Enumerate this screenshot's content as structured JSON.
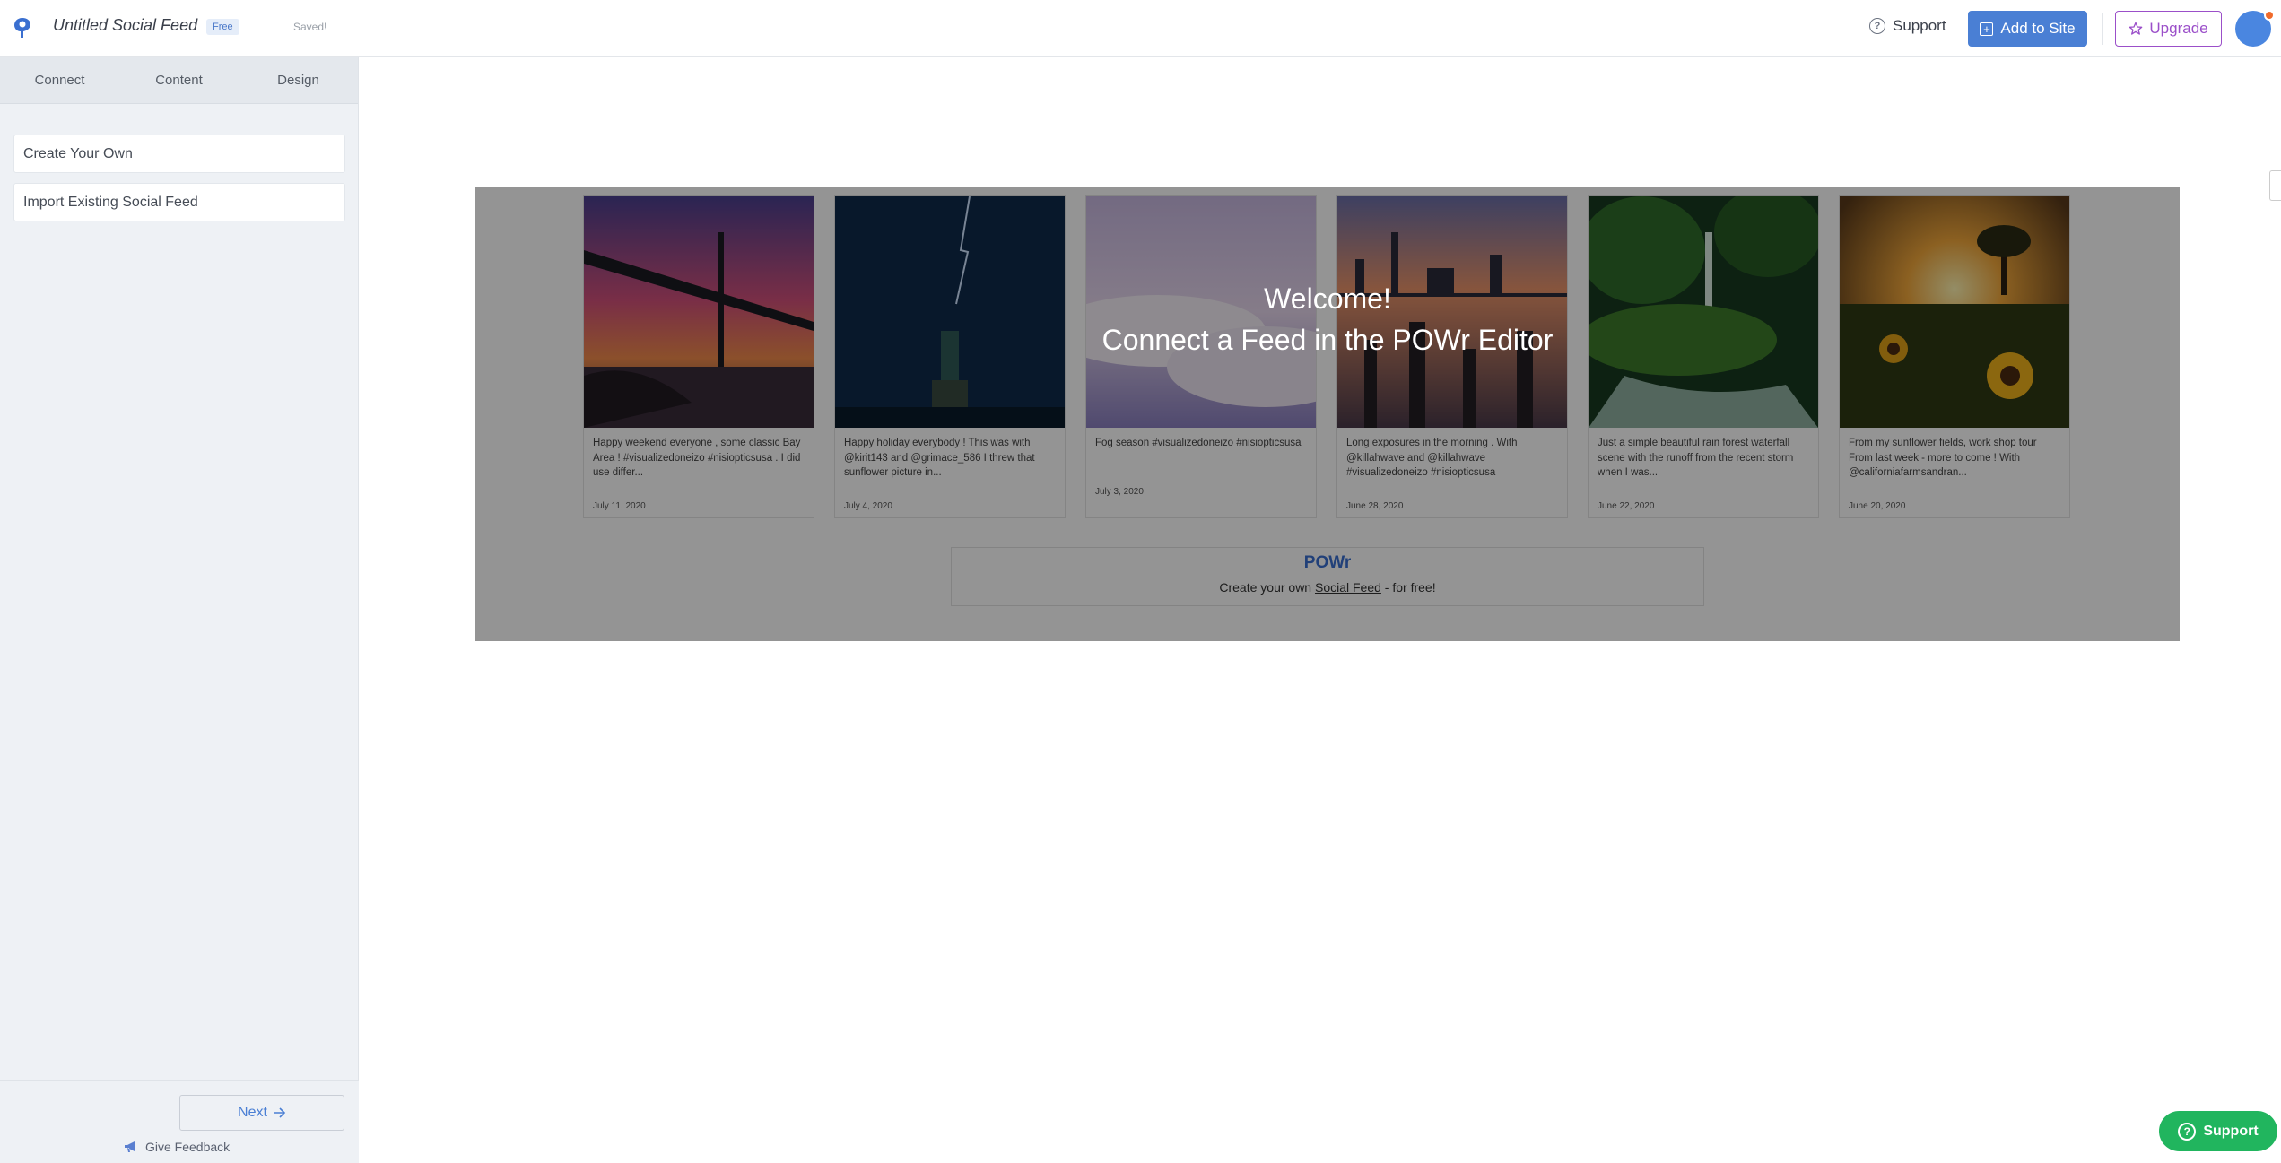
{
  "header": {
    "title": "Untitled Social Feed",
    "plan_badge": "Free",
    "save_status": "Saved!",
    "support_label": "Support",
    "add_to_site_label": "Add to Site",
    "upgrade_label": "Upgrade"
  },
  "sidebar": {
    "tabs": [
      {
        "label": "Connect"
      },
      {
        "label": "Content"
      },
      {
        "label": "Design"
      }
    ],
    "items": [
      {
        "label": "Create Your Own"
      },
      {
        "label": "Import Existing Social Feed"
      }
    ],
    "next_label": "Next",
    "feedback_label": "Give Feedback"
  },
  "preview": {
    "welcome_line1": "Welcome!",
    "welcome_line2": "Connect a Feed in the POWr Editor",
    "posts": [
      {
        "caption": "Happy weekend everyone , some classic Bay Area ! #visualizedoneizo #nisiopticsusa . I did use differ...",
        "date": "July 11, 2020"
      },
      {
        "caption": "Happy holiday everybody ! This was with @kirit143 and @grimace_586 I threw that sunflower picture in...",
        "date": "July 4, 2020"
      },
      {
        "caption": "Fog season #visualizedoneizo #nisiopticsusa",
        "date": "July 3, 2020"
      },
      {
        "caption": "Long exposures in the morning . With @killahwave and @killahwave #visualizedoneizo #nisiopticsusa",
        "date": "June 28, 2020"
      },
      {
        "caption": "Just a simple beautiful rain forest waterfall scene with the runoff from the recent storm when I was...",
        "date": "June 22, 2020"
      },
      {
        "caption": "From my sunflower fields, work shop tour From last week - more to come ! With @californiafarmsandran...",
        "date": "June 20, 2020"
      }
    ],
    "branding": {
      "logo_text": "POWr",
      "text_before": "Create your own ",
      "link_text": "Social Feed",
      "text_after": " - for free!"
    }
  },
  "floating_support_label": "Support",
  "colors": {
    "primary": "#4a7fd4",
    "upgrade": "#9b4fc9",
    "support_green": "#21b55e",
    "sidebar_bg": "#eef1f5"
  }
}
